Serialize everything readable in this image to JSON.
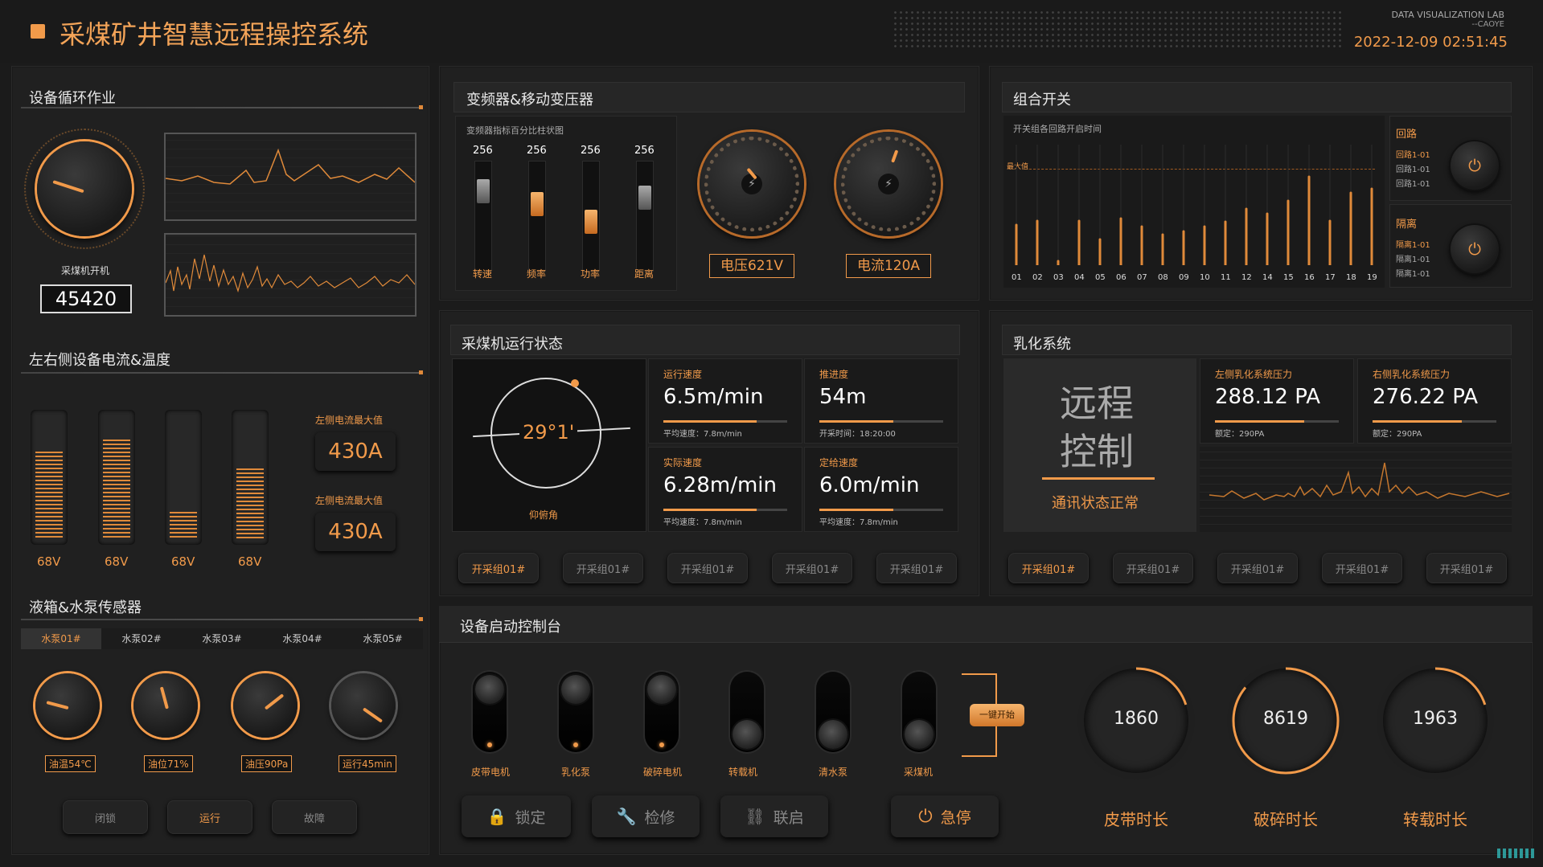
{
  "header": {
    "title": "采煤矿井智慧远程操控系统",
    "lab": "DATA VISUALIZATION LAB",
    "author": "--CAOYE",
    "datetime": "2022-12-09 02:51:45"
  },
  "colors": {
    "accent": "#f19a4a",
    "bg": "#1b1b1b",
    "panel": "#202020"
  },
  "cycle": {
    "title": "设备循环作业",
    "knob_label": "采煤机开机",
    "counter": "45420"
  },
  "current": {
    "title": "左右侧设备电流&温度",
    "bars": [
      {
        "label": "68V",
        "level": 0.72
      },
      {
        "label": "68V",
        "level": 0.82
      },
      {
        "label": "68V",
        "level": 0.22
      },
      {
        "label": "68V",
        "level": 0.58
      }
    ],
    "max1_label": "左侧电流最大值",
    "max1_value": "430A",
    "max2_label": "左侧电流最大值",
    "max2_value": "430A"
  },
  "pump": {
    "title": "液箱&水泵传感器",
    "tabs": [
      "水泵01#",
      "水泵02#",
      "水泵03#",
      "水泵04#",
      "水泵05#"
    ],
    "gauges": [
      "油温54℃",
      "油位71%",
      "油压90Pa",
      "运行45min"
    ],
    "buttons": [
      "闭锁",
      "运行",
      "故障"
    ]
  },
  "inverter": {
    "title": "变频器&移动变压器",
    "chart_title": "变频器指标百分比柱状图",
    "sliders": [
      {
        "top": "256",
        "label": "转速"
      },
      {
        "top": "256",
        "label": "频率"
      },
      {
        "top": "256",
        "label": "功率"
      },
      {
        "top": "256",
        "label": "距离"
      }
    ],
    "voltage": "电压621V",
    "current": "电流120A"
  },
  "switch": {
    "title": "组合开关",
    "chart_title": "开关组各回路开启时间",
    "max_label": "最大值",
    "xticks": [
      "01",
      "02",
      "03",
      "04",
      "05",
      "06",
      "07",
      "08",
      "09",
      "10",
      "11",
      "12",
      "14",
      "15",
      "16",
      "17",
      "18",
      "19"
    ],
    "loop_title": "回路",
    "loop_items": [
      "回路1-01",
      "回路1-01",
      "回路1-01"
    ],
    "iso_title": "隔离",
    "iso_items": [
      "隔离1-01",
      "隔离1-01",
      "隔离1-01"
    ]
  },
  "shearer": {
    "title": "采煤机运行状态",
    "angle": "29°1'",
    "angle_label": "仰俯角",
    "cards": [
      {
        "t": "运行速度",
        "v": "6.5m/min",
        "s": "平均速度：7.8m/min",
        "level": 0.75
      },
      {
        "t": "推进度",
        "v": "54m",
        "s": "开采时间：18:20:00",
        "level": 0.6
      },
      {
        "t": "实际速度",
        "v": "6.28m/min",
        "s": "平均速度：7.8m/min",
        "level": 0.75
      },
      {
        "t": "定给速度",
        "v": "6.0m/min",
        "s": "平均速度：7.8m/min",
        "level": 0.6
      }
    ],
    "buttons": [
      "开采组01#",
      "开采组01#",
      "开采组01#",
      "开采组01#",
      "开采组01#"
    ]
  },
  "emulsion": {
    "title": "乳化系统",
    "remote1": "远程",
    "remote2": "控制",
    "status": "通讯状态正常",
    "cards": [
      {
        "t": "左侧乳化系统压力",
        "v": "288.12 PA",
        "s": "额定：290PA",
        "level": 0.72
      },
      {
        "t": "右侧乳化系统压力",
        "v": "276.22 PA",
        "s": "额定：290PA",
        "level": 0.72
      }
    ],
    "buttons": [
      "开采组01#",
      "开采组01#",
      "开采组01#",
      "开采组01#",
      "开采组01#"
    ]
  },
  "console": {
    "title": "设备启动控制台",
    "switches": [
      {
        "label": "皮带电机",
        "on": true
      },
      {
        "label": "乳化泵",
        "on": true
      },
      {
        "label": "破碎电机",
        "on": true
      },
      {
        "label": "转载机",
        "on": false
      },
      {
        "label": "清水泵",
        "on": false
      },
      {
        "label": "采煤机",
        "on": false
      }
    ],
    "one_key": "一键开始",
    "buttons": [
      "锁定",
      "检修",
      "联启",
      "急停"
    ],
    "rings": [
      {
        "value": "1860",
        "label": "皮带时长",
        "level": 0.2
      },
      {
        "value": "8619",
        "label": "破碎时长",
        "level": 0.86
      },
      {
        "value": "1963",
        "label": "转载时长",
        "level": 0.2
      }
    ]
  }
}
